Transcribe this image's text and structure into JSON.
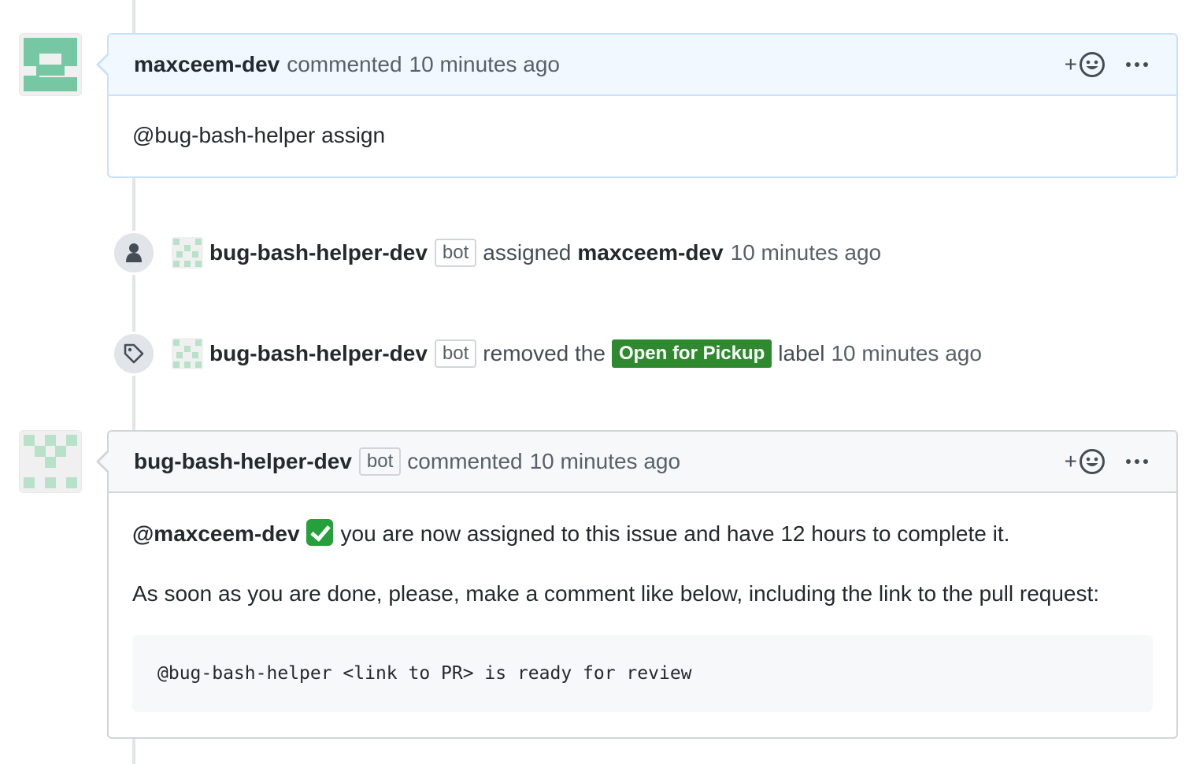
{
  "comment1": {
    "author": "maxceem-dev",
    "action": "commented",
    "time": "10 minutes ago",
    "react_plus": "+",
    "body": "@bug-bash-helper assign"
  },
  "event_assign": {
    "actor": "bug-bash-helper-dev",
    "bot_badge": "bot",
    "verb": "assigned",
    "target": "maxceem-dev",
    "time": "10 minutes ago",
    "icon": "person-icon"
  },
  "event_label": {
    "actor": "bug-bash-helper-dev",
    "bot_badge": "bot",
    "verb": "removed the",
    "label": "Open for Pickup",
    "label_color": "#2f8a2f",
    "suffix": "label",
    "time": "10 minutes ago",
    "icon": "tag-icon"
  },
  "comment2": {
    "author": "bug-bash-helper-dev",
    "bot_badge": "bot",
    "action": "commented",
    "time": "10 minutes ago",
    "react_plus": "+",
    "mention": "@maxceem-dev",
    "line1": "you are now assigned to this issue and have 12 hours to complete it.",
    "line2": "As soon as you are done, please, make a comment like below, including the link to the pull request:",
    "code": "@bug-bash-helper <link to PR> is ready for review"
  },
  "colors": {
    "accent_blue_border": "#c8e1ff",
    "header_blue_bg": "#f1f8ff",
    "bot_border": "#d1d5da",
    "check_green": "#26a03a"
  }
}
